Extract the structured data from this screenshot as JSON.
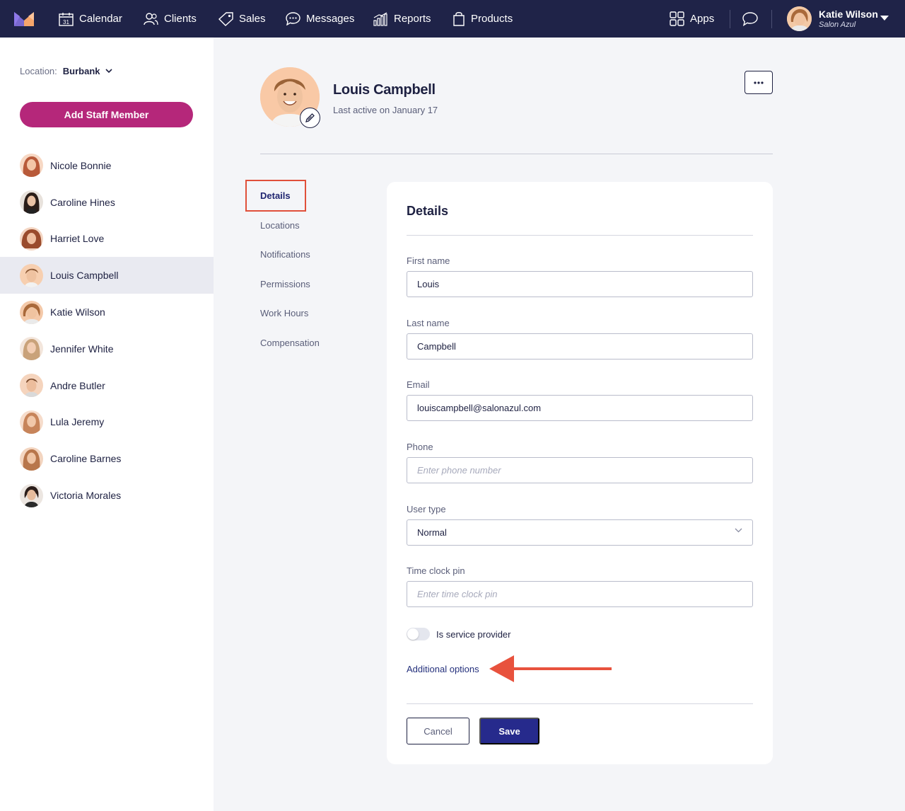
{
  "nav": {
    "items": [
      {
        "label": "Calendar",
        "icon": "calendar-icon"
      },
      {
        "label": "Clients",
        "icon": "clients-icon"
      },
      {
        "label": "Sales",
        "icon": "tag-icon"
      },
      {
        "label": "Messages",
        "icon": "chat-bubble-icon"
      },
      {
        "label": "Reports",
        "icon": "bar-chart-icon"
      },
      {
        "label": "Products",
        "icon": "shopping-bag-icon"
      }
    ],
    "calendar_day": "31",
    "apps_label": "Apps",
    "user": {
      "name": "Katie Wilson",
      "business": "Salon Azul"
    }
  },
  "sidebar": {
    "location_label": "Location:",
    "location_value": "Burbank",
    "add_button": "Add Staff Member",
    "staff": [
      {
        "name": "Nicole Bonnie",
        "active": false
      },
      {
        "name": "Caroline Hines",
        "active": false
      },
      {
        "name": "Harriet Love",
        "active": false
      },
      {
        "name": "Louis Campbell",
        "active": true
      },
      {
        "name": "Katie Wilson",
        "active": false
      },
      {
        "name": "Jennifer White",
        "active": false
      },
      {
        "name": "Andre Butler",
        "active": false
      },
      {
        "name": "Lula Jeremy",
        "active": false
      },
      {
        "name": "Caroline Barnes",
        "active": false
      },
      {
        "name": "Victoria Morales",
        "active": false
      }
    ]
  },
  "profile": {
    "name": "Louis Campbell",
    "last_active": "Last active on January 17"
  },
  "section_nav": {
    "active": "Details",
    "items": [
      "Locations",
      "Notifications",
      "Permissions",
      "Work Hours",
      "Compensation"
    ]
  },
  "form": {
    "title": "Details",
    "first_name": {
      "label": "First name",
      "value": "Louis"
    },
    "last_name": {
      "label": "Last name",
      "value": "Campbell"
    },
    "email": {
      "label": "Email",
      "value": "louiscampbell@salonazul.com"
    },
    "phone": {
      "label": "Phone",
      "placeholder": "Enter phone number"
    },
    "user_type": {
      "label": "User type",
      "value": "Normal"
    },
    "time_clock": {
      "label": "Time clock pin",
      "placeholder": "Enter time clock pin"
    },
    "service_provider": {
      "label": "Is service provider",
      "on": false
    },
    "additional_options": "Additional options",
    "cancel": "Cancel",
    "save": "Save"
  },
  "colors": {
    "nav_bg": "#1f2348",
    "brand_magenta": "#b5277a",
    "primary_blue": "#262a8c",
    "highlight_red": "#e0503a"
  }
}
